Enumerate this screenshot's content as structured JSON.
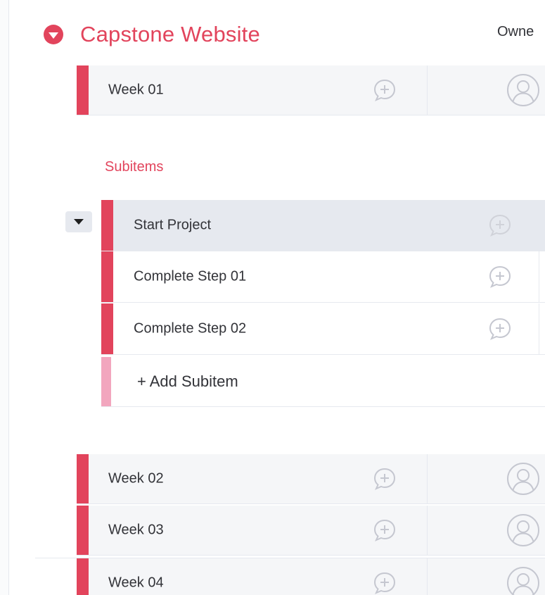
{
  "group": {
    "title": "Capstone Website",
    "color": "#e2445c",
    "owner_column_label": "Owne"
  },
  "items": [
    {
      "label": "Week 01"
    },
    {
      "label": "Week 02"
    },
    {
      "label": "Week 03"
    },
    {
      "label": "Week 04"
    }
  ],
  "subitems": {
    "section_label": "Subitems",
    "rows": [
      {
        "label": "Start Project"
      },
      {
        "label": "Complete Step 01"
      },
      {
        "label": "Complete Step 02"
      }
    ],
    "add_label": "+ Add Subitem"
  },
  "icons": {
    "collapse": "chevron-down-circle-icon",
    "update": "add-update-bubble-icon",
    "owner": "person-avatar-icon",
    "subitems_toggle": "caret-down-icon"
  }
}
